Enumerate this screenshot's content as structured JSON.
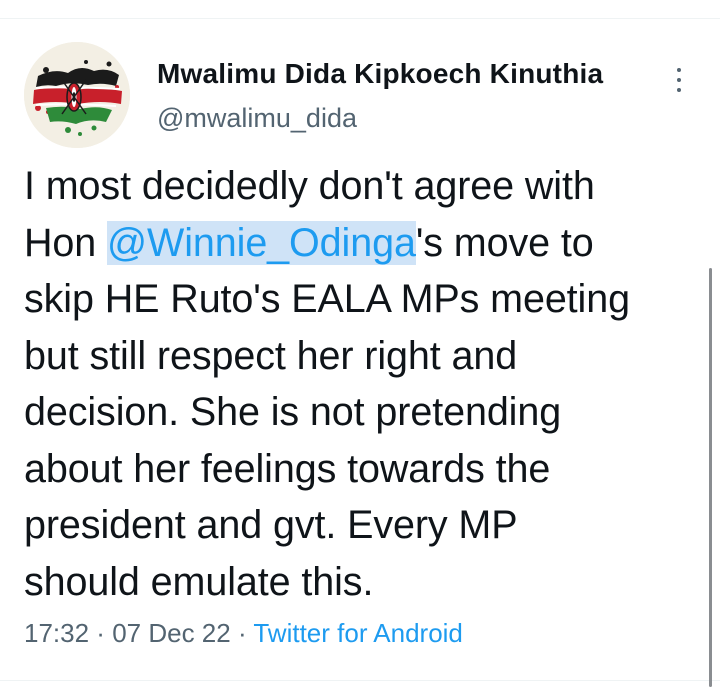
{
  "author": {
    "display_name": "Mwalimu Dida Kipkoech Kinuthia",
    "handle": "@mwalimu_dida",
    "avatar_icon": "kenya-flag-splatter-avatar"
  },
  "menu": {
    "icon": "more-vertical-icon"
  },
  "tweet": {
    "line1": "I most decidedly don't agree with",
    "line2_prefix": "Hon ",
    "mention": "@Winnie_Odinga",
    "line2_suffix": "'s move to",
    "line3": "skip HE Ruto's EALA MPs meeting",
    "line4": "but still respect her right and",
    "line5": "decision. She is not pretending",
    "line6": "about her feelings towards the",
    "line7": "president and gvt. Every MP",
    "line8": "should emulate this."
  },
  "meta": {
    "time": "17:32",
    "sep1": " · ",
    "date": "07 Dec 22",
    "sep2": " · ",
    "source": "Twitter for Android"
  },
  "colors": {
    "link": "#1d9bf0",
    "mention_highlight": "#cfe3f7",
    "secondary_text": "#536471"
  }
}
